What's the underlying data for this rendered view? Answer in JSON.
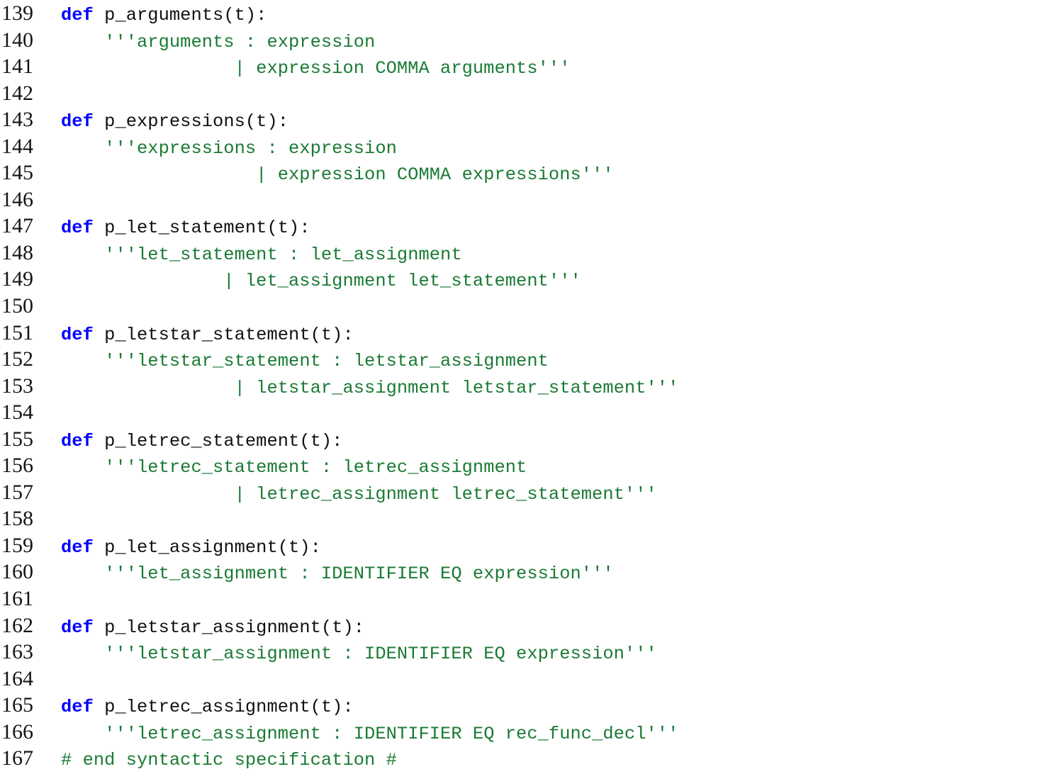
{
  "editor": {
    "language": "Python",
    "background_color": "#ffffff",
    "first_line_number": 139,
    "last_line_number": 167,
    "colors": {
      "keyword": "#0000ff",
      "string": "#1a7a33",
      "comment": "#1a7a33",
      "plain_text": "#111111",
      "line_number": "#151515"
    }
  },
  "lines": [
    {
      "number": "139",
      "text": "def p_arguments(t):",
      "tokens": [
        {
          "kind": "kw",
          "text": "def"
        },
        {
          "kind": "plain",
          "text": " p_arguments(t):"
        }
      ]
    },
    {
      "number": "140",
      "text": "    '''arguments : expression",
      "tokens": [
        {
          "kind": "plain",
          "text": "    "
        },
        {
          "kind": "str",
          "text": "'''arguments : expression"
        }
      ]
    },
    {
      "number": "141",
      "text": "                | expression COMMA arguments'''",
      "tokens": [
        {
          "kind": "str",
          "text": "                | expression COMMA arguments'''"
        }
      ]
    },
    {
      "number": "142",
      "text": "",
      "tokens": []
    },
    {
      "number": "143",
      "text": "def p_expressions(t):",
      "tokens": [
        {
          "kind": "kw",
          "text": "def"
        },
        {
          "kind": "plain",
          "text": " p_expressions(t):"
        }
      ]
    },
    {
      "number": "144",
      "text": "    '''expressions : expression",
      "tokens": [
        {
          "kind": "plain",
          "text": "    "
        },
        {
          "kind": "str",
          "text": "'''expressions : expression"
        }
      ]
    },
    {
      "number": "145",
      "text": "                  | expression COMMA expressions'''",
      "tokens": [
        {
          "kind": "str",
          "text": "                  | expression COMMA expressions'''"
        }
      ]
    },
    {
      "number": "146",
      "text": "",
      "tokens": []
    },
    {
      "number": "147",
      "text": "def p_let_statement(t):",
      "tokens": [
        {
          "kind": "kw",
          "text": "def"
        },
        {
          "kind": "plain",
          "text": " p_let_statement(t):"
        }
      ]
    },
    {
      "number": "148",
      "text": "    '''let_statement : let_assignment",
      "tokens": [
        {
          "kind": "plain",
          "text": "    "
        },
        {
          "kind": "str",
          "text": "'''let_statement : let_assignment"
        }
      ]
    },
    {
      "number": "149",
      "text": "               | let_assignment let_statement'''",
      "tokens": [
        {
          "kind": "str",
          "text": "               | let_assignment let_statement'''"
        }
      ]
    },
    {
      "number": "150",
      "text": "",
      "tokens": []
    },
    {
      "number": "151",
      "text": "def p_letstar_statement(t):",
      "tokens": [
        {
          "kind": "kw",
          "text": "def"
        },
        {
          "kind": "plain",
          "text": " p_letstar_statement(t):"
        }
      ]
    },
    {
      "number": "152",
      "text": "    '''letstar_statement : letstar_assignment",
      "tokens": [
        {
          "kind": "plain",
          "text": "    "
        },
        {
          "kind": "str",
          "text": "'''letstar_statement : letstar_assignment"
        }
      ]
    },
    {
      "number": "153",
      "text": "                | letstar_assignment letstar_statement'''",
      "tokens": [
        {
          "kind": "str",
          "text": "                | letstar_assignment letstar_statement'''"
        }
      ]
    },
    {
      "number": "154",
      "text": "",
      "tokens": []
    },
    {
      "number": "155",
      "text": "def p_letrec_statement(t):",
      "tokens": [
        {
          "kind": "kw",
          "text": "def"
        },
        {
          "kind": "plain",
          "text": " p_letrec_statement(t):"
        }
      ]
    },
    {
      "number": "156",
      "text": "    '''letrec_statement : letrec_assignment",
      "tokens": [
        {
          "kind": "plain",
          "text": "    "
        },
        {
          "kind": "str",
          "text": "'''letrec_statement : letrec_assignment"
        }
      ]
    },
    {
      "number": "157",
      "text": "                | letrec_assignment letrec_statement'''",
      "tokens": [
        {
          "kind": "str",
          "text": "                | letrec_assignment letrec_statement'''"
        }
      ]
    },
    {
      "number": "158",
      "text": "",
      "tokens": []
    },
    {
      "number": "159",
      "text": "def p_let_assignment(t):",
      "tokens": [
        {
          "kind": "kw",
          "text": "def"
        },
        {
          "kind": "plain",
          "text": " p_let_assignment(t):"
        }
      ]
    },
    {
      "number": "160",
      "text": "    '''let_assignment : IDENTIFIER EQ expression'''",
      "tokens": [
        {
          "kind": "plain",
          "text": "    "
        },
        {
          "kind": "str",
          "text": "'''let_assignment : IDENTIFIER EQ expression'''"
        }
      ]
    },
    {
      "number": "161",
      "text": "",
      "tokens": []
    },
    {
      "number": "162",
      "text": "def p_letstar_assignment(t):",
      "tokens": [
        {
          "kind": "kw",
          "text": "def"
        },
        {
          "kind": "plain",
          "text": " p_letstar_assignment(t):"
        }
      ]
    },
    {
      "number": "163",
      "text": "    '''letstar_assignment : IDENTIFIER EQ expression'''",
      "tokens": [
        {
          "kind": "plain",
          "text": "    "
        },
        {
          "kind": "str",
          "text": "'''letstar_assignment : IDENTIFIER EQ expression'''"
        }
      ]
    },
    {
      "number": "164",
      "text": "",
      "tokens": []
    },
    {
      "number": "165",
      "text": "def p_letrec_assignment(t):",
      "tokens": [
        {
          "kind": "kw",
          "text": "def"
        },
        {
          "kind": "plain",
          "text": " p_letrec_assignment(t):"
        }
      ]
    },
    {
      "number": "166",
      "text": "    '''letrec_assignment : IDENTIFIER EQ rec_func_decl'''",
      "tokens": [
        {
          "kind": "plain",
          "text": "    "
        },
        {
          "kind": "str",
          "text": "'''letrec_assignment : IDENTIFIER EQ rec_func_decl'''"
        }
      ]
    },
    {
      "number": "167",
      "text": "# end syntactic specification #",
      "tokens": [
        {
          "kind": "comment",
          "text": "# end syntactic specification #"
        }
      ]
    }
  ]
}
